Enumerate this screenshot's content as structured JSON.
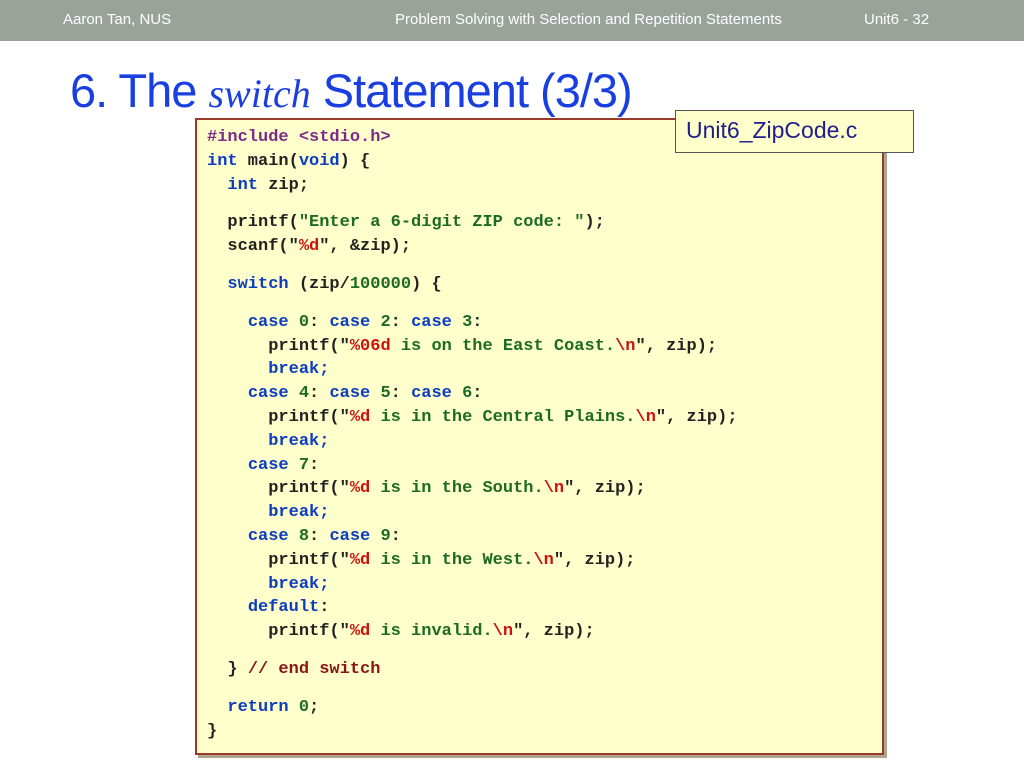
{
  "header": {
    "author": "Aaron Tan, NUS",
    "topic": "Problem Solving with Selection and Repetition Statements",
    "page": "Unit6 - 32"
  },
  "slide": {
    "title_prefix": "6. The",
    "title_italic": "switch",
    "title_suffix": "Statement (3/3)",
    "filename": "Unit6_ZipCode.c"
  },
  "code": {
    "include": "#include <stdio.h>",
    "main": [
      "int",
      " main(",
      "void",
      ") {"
    ],
    "decl": [
      "int",
      " zip;"
    ],
    "printf_prompt": [
      "printf(",
      "\"Enter a 6-digit ZIP code: \"",
      ");"
    ],
    "scanf": [
      "scanf(\"",
      "%d",
      "\", &zip);"
    ],
    "switch": [
      "switch",
      " (zip/",
      "100000",
      ") {"
    ],
    "case_east": [
      "case",
      " ",
      "0",
      ": ",
      "case",
      " ",
      "2",
      ": ",
      "case",
      " ",
      "3",
      ":"
    ],
    "printf_east": [
      "printf(\"",
      "%06d",
      " is on the East Coast.",
      "\\n",
      "\", zip);"
    ],
    "break1": "break;",
    "case_central": [
      "case",
      " ",
      "4",
      ": ",
      "case",
      " ",
      "5",
      ": ",
      "case",
      " ",
      "6",
      ":"
    ],
    "printf_central": [
      "printf(\"",
      "%d",
      " is in the Central Plains.",
      "\\n",
      "\", zip);"
    ],
    "break2": "break;",
    "case_south": [
      "case",
      " ",
      "7",
      ":"
    ],
    "printf_south": [
      "printf(\"",
      "%d",
      " is in the South.",
      "\\n",
      "\", zip);"
    ],
    "break3": "break;",
    "case_west": [
      "case",
      " ",
      "8",
      ": ",
      "case",
      " ",
      "9",
      ":"
    ],
    "printf_west": [
      "printf(\"",
      "%d",
      " is in the West.",
      "\\n",
      "\", zip);"
    ],
    "break4": "break;",
    "default": [
      "default",
      ":"
    ],
    "printf_invalid": [
      "printf(\"",
      "%d",
      " is invalid.",
      "\\n",
      "\", zip);"
    ],
    "end_switch": [
      "} ",
      "// end switch"
    ],
    "return": [
      "return",
      " ",
      "0",
      ";"
    ],
    "close": "}"
  }
}
